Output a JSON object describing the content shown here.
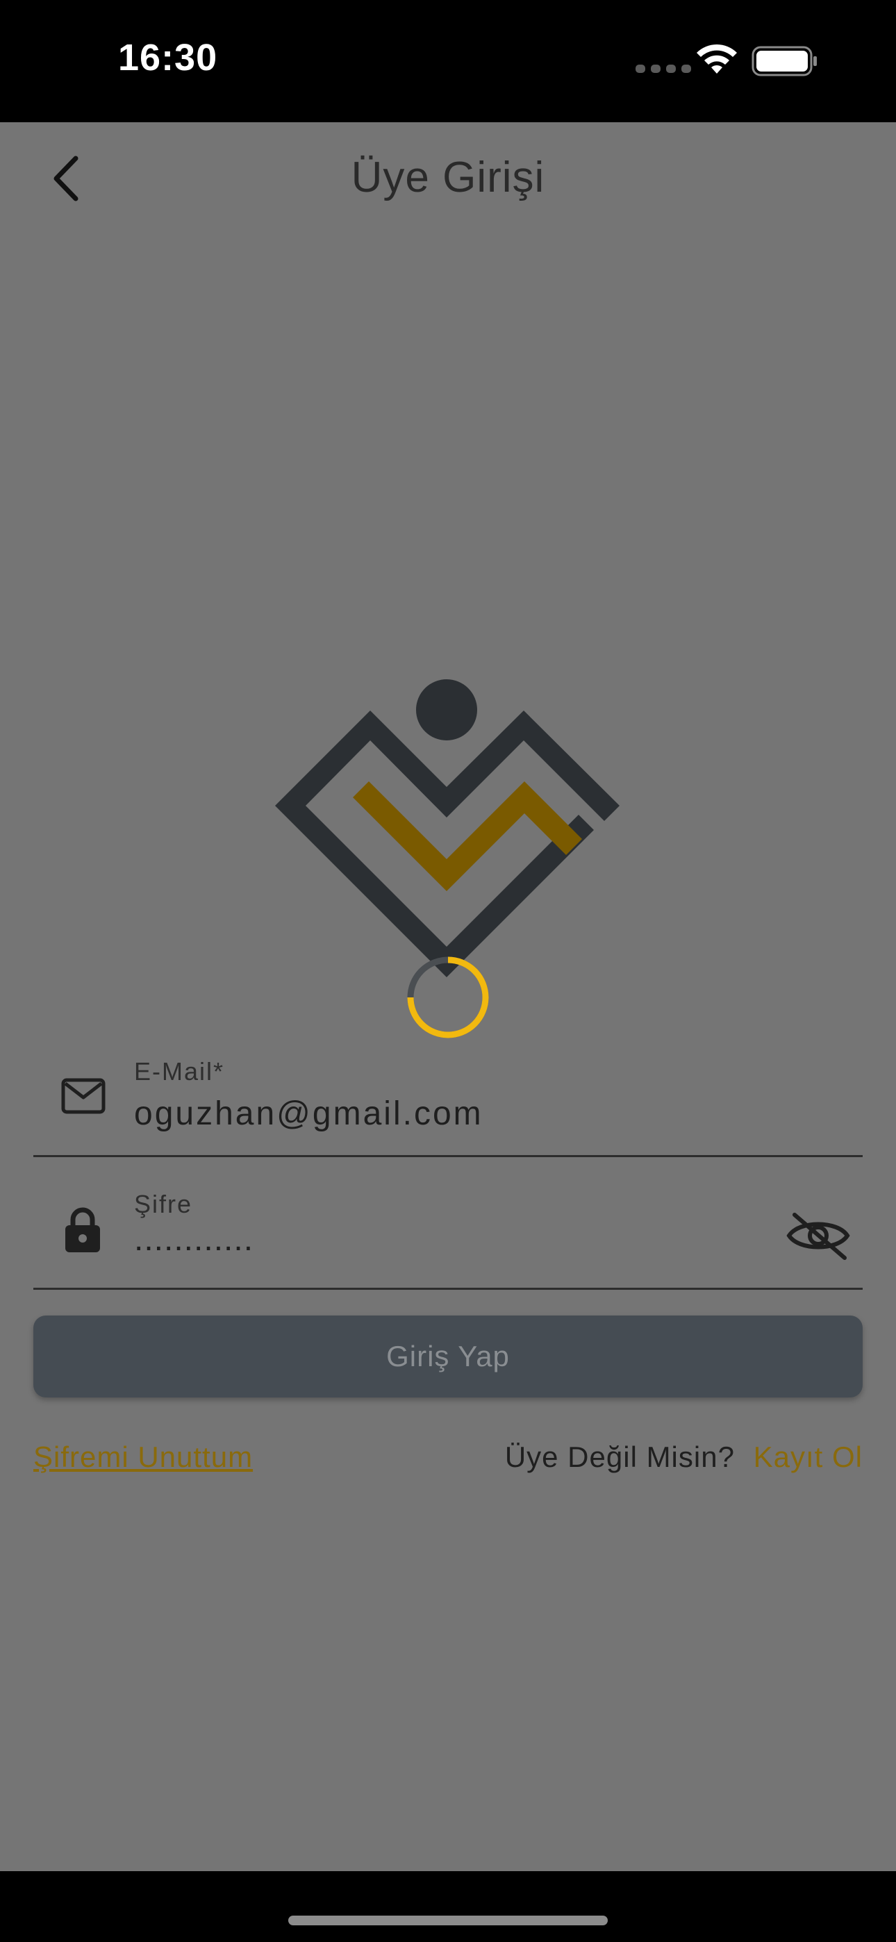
{
  "status_bar": {
    "time": "16:30"
  },
  "header": {
    "title": "Üye Girişi",
    "back_icon": "chevron-left-icon"
  },
  "logo": {
    "colors": {
      "dark": "#2b2f33",
      "accent": "#7a5a00"
    }
  },
  "spinner": {
    "track_color": "#4a4e52",
    "accent_color": "#f2b90f"
  },
  "form": {
    "email": {
      "label": "E-Mail*",
      "value": "oguzhan@gmail.com",
      "icon": "mail-icon"
    },
    "password": {
      "label": "Şifre",
      "value": "............",
      "icon": "lock-icon",
      "toggle_icon": "eye-off-icon"
    },
    "submit_label": "Giriş Yap"
  },
  "links": {
    "forgot_password": "Şifremi Unuttum",
    "signup_question": "Üye Değil Misin?",
    "signup_link": "Kayıt Ol"
  },
  "colors": {
    "overlay_background": "#757575",
    "button_background": "#454c53",
    "link_accent": "#8a6a0c"
  }
}
